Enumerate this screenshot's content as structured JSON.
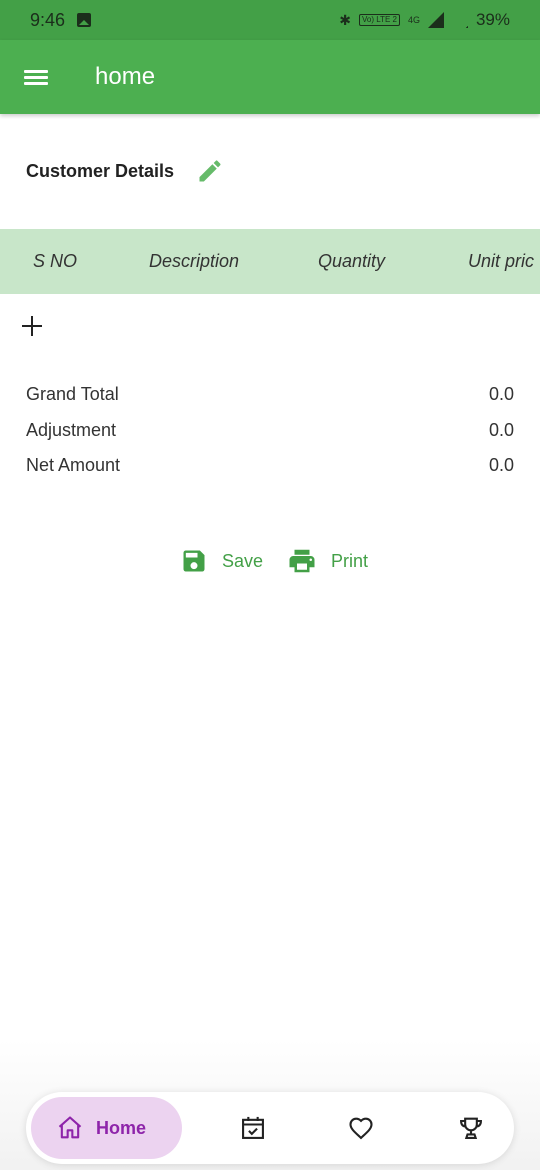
{
  "status_bar": {
    "time": "9:46",
    "network": "4G",
    "volte": "Vo) LTE 2",
    "battery": "39%"
  },
  "app_bar": {
    "title": "home"
  },
  "customer": {
    "label": "Customer Details"
  },
  "table": {
    "columns": [
      "S NO",
      "Description",
      "Quantity",
      "Unit pric"
    ]
  },
  "totals": [
    {
      "label": "Grand Total",
      "value": "0.0"
    },
    {
      "label": "Adjustment",
      "value": "0.0"
    },
    {
      "label": "Net Amount",
      "value": "0.0"
    }
  ],
  "actions": {
    "save_label": "Save",
    "print_label": "Print"
  },
  "bottom_nav": {
    "home_label": "Home"
  },
  "colors": {
    "app_bar": "#4caf50",
    "status_bar": "#43a047",
    "table_header": "#c8e6c9",
    "action": "#43a047",
    "nav_active_bg": "#ecd3f0",
    "nav_active_fg": "#8e24aa"
  },
  "icons": [
    "menu-icon",
    "edit-icon",
    "add-icon",
    "save-icon",
    "print-icon",
    "home-icon",
    "calendar-check-icon",
    "heart-icon",
    "trophy-icon"
  ]
}
